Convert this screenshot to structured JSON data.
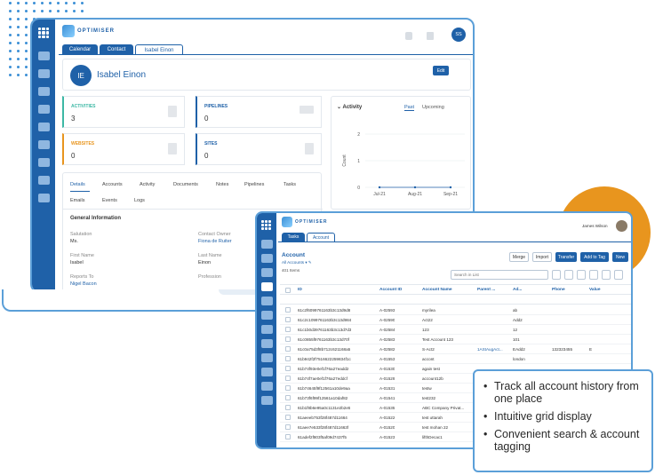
{
  "laptop": {
    "logo_text": "OPTIMISER",
    "avatar_initials": "SS",
    "tabs": [
      {
        "label": "Calendar",
        "active": false
      },
      {
        "label": "Contact",
        "active": false
      },
      {
        "label": "Isabel Einon",
        "active": true
      }
    ],
    "contact": {
      "initials": "IE",
      "name": "Isabel Einon",
      "edit_label": "Edit"
    },
    "stats": [
      {
        "label": "ACTIVITIES",
        "value": "3",
        "color": "#3db8a5"
      },
      {
        "label": "PIPELINES",
        "value": "0",
        "color": "#1f61a8"
      },
      {
        "label": "WEBSITES",
        "value": "0",
        "color": "#e8951e"
      },
      {
        "label": "SITES",
        "value": "0",
        "color": "#1f61a8"
      }
    ],
    "activity": {
      "title": "Activity",
      "tab_past": "Past",
      "tab_upcoming": "Upcoming"
    },
    "detail_tabs": [
      "Details",
      "Accounts",
      "Activity",
      "Documents",
      "Notes",
      "Pipelines",
      "Tasks"
    ],
    "detail_tabs2": [
      "Emails",
      "Events",
      "Logs"
    ],
    "general": {
      "heading": "General Information",
      "fields": [
        {
          "label": "Salutation",
          "value": "Ms."
        },
        {
          "label": "Contact Owner",
          "value": "Fiona de Ruiter"
        },
        {
          "label": "First Name",
          "value": "Isabel"
        },
        {
          "label": "Last Name",
          "value": "Einon"
        },
        {
          "label": "Reports To",
          "value": "Nigel Bacon"
        },
        {
          "label": "Profession",
          "value": ""
        }
      ]
    }
  },
  "chart_data": {
    "type": "line",
    "categories": [
      "Jul-21",
      "Aug-21",
      "Sep-21"
    ],
    "series": [
      {
        "values": [
          0,
          0,
          0
        ]
      }
    ],
    "ylabel": "Count",
    "ylim": [
      0,
      2
    ],
    "yticks": [
      "0",
      "1",
      "2"
    ],
    "grid": true
  },
  "tablet": {
    "logo_text": "OPTIMISER",
    "user_name": "James Wilson",
    "tabs": [
      {
        "label": "Tasks",
        "active": false
      },
      {
        "label": "Account",
        "active": true
      }
    ],
    "title": "Account",
    "view_label": "All Accounts",
    "count_text": "401 Items",
    "buttons": [
      "Merge",
      "Import",
      "Transfer",
      "Add to Tag",
      "New"
    ],
    "search_placeholder": "Search in List",
    "columns": [
      "ID",
      "Account ID",
      "Account Name",
      "Parent ...",
      "Ad...",
      "Phone",
      "Value"
    ],
    "rows": [
      [
        "61c2f6099761163b3c13d9d8",
        "A-02593",
        "myrilea",
        "",
        "ab",
        "",
        ""
      ],
      [
        "61c2c1099761163b3c13d984",
        "A-02590",
        "Act22",
        "",
        "Add2",
        "",
        ""
      ],
      [
        "61c1b0d39761163b3c13d7d3",
        "A-02584",
        "123",
        "",
        "12",
        "",
        ""
      ],
      [
        "61c0855f9761163b3c13d70f",
        "A-02583",
        "Test Account 123",
        "",
        "101",
        "",
        ""
      ],
      [
        "61c0a75d3f8b712c621168a5",
        "A-02582",
        "S-Act2",
        "1AStAugAct...",
        "EAdd2",
        "132323455",
        "E"
      ],
      [
        "61b942f2f7516622259834f1c",
        "A-01553",
        "accont",
        "",
        "london",
        "",
        ""
      ],
      [
        "61b74f93e0ef1f76a27eadd2",
        "A-01530",
        "again test",
        "",
        "",
        "",
        ""
      ],
      [
        "61b74f7ae0ef1f76a27eddcf",
        "A-01529",
        "account12b",
        "",
        "",
        "",
        ""
      ],
      [
        "61b74645f9f12561a10de9aa",
        "A-01531",
        "testw",
        "",
        "",
        "",
        ""
      ],
      [
        "61b73f6f99f12561a10daf82",
        "A-01541",
        "test232",
        "",
        "",
        "",
        ""
      ],
      [
        "61b1f8b6e95a0c1131e2b2e5",
        "A-01535",
        "ABC Company Privat...",
        "",
        "",
        "",
        ""
      ],
      [
        "61aeeeb753f28f487d11664",
        "A-01522",
        "test uttarah",
        "",
        "",
        "",
        ""
      ],
      [
        "61aee7e533f28f487d11663f",
        "A-01520",
        "test mohan 22",
        "",
        "",
        "",
        ""
      ],
      [
        "61adef2f803f5af09d7437f5",
        "A-01523",
        "lifthDecac1",
        "",
        "",
        "",
        ""
      ]
    ]
  },
  "features": [
    "Track all account history from one place",
    "Intuitive grid display",
    "Convenient search & account tagging"
  ]
}
